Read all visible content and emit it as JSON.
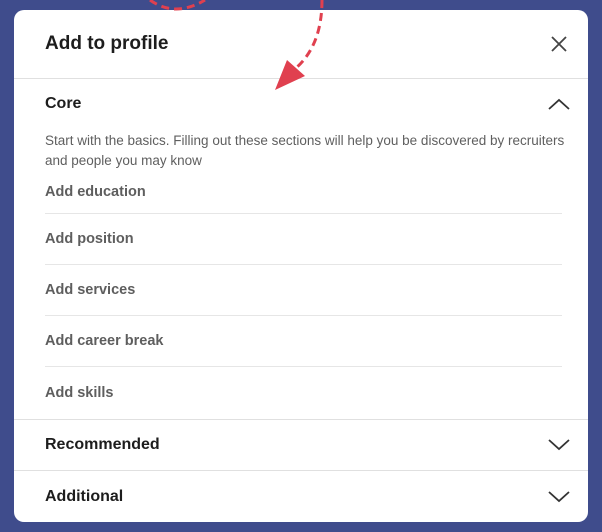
{
  "modal": {
    "title": "Add to profile"
  },
  "sections": {
    "core": {
      "title": "Core",
      "description": "Start with the basics. Filling out these sections will help you be discovered by recruiters and people you may know",
      "items": [
        {
          "label": "Add education"
        },
        {
          "label": "Add position"
        },
        {
          "label": "Add services"
        },
        {
          "label": "Add career break"
        },
        {
          "label": "Add skills"
        }
      ],
      "state": "expanded"
    },
    "recommended": {
      "title": "Recommended",
      "state": "collapsed"
    },
    "additional": {
      "title": "Additional",
      "state": "collapsed"
    }
  },
  "colors": {
    "frame": "#3f4c8c",
    "annotation_arrow": "#e0404f",
    "text_primary": "#1d1d1d",
    "text_secondary": "#5e5e5e"
  },
  "icons": [
    "close-icon",
    "chevron-up-icon",
    "chevron-down-icon"
  ]
}
